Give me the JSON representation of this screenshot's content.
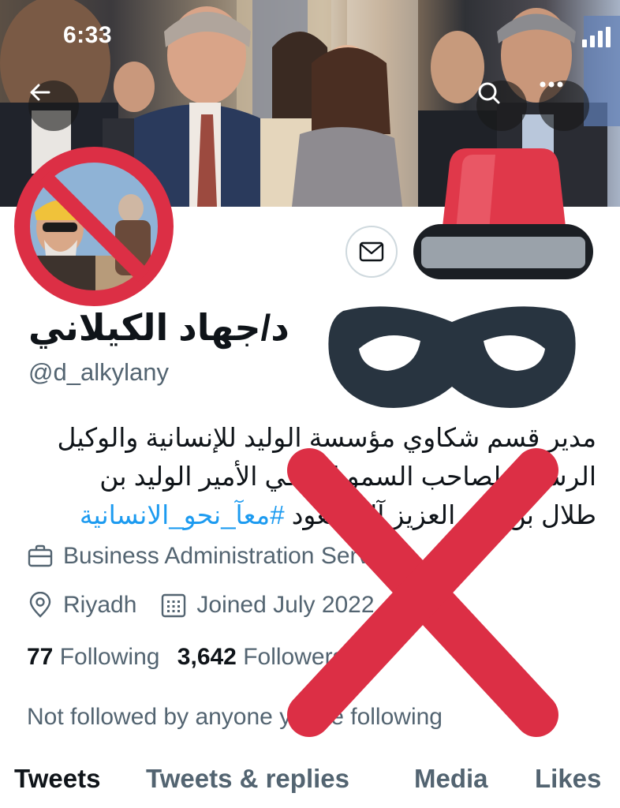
{
  "status_bar": {
    "time": "6:33"
  },
  "header": {
    "back_icon": "arrow-left-icon",
    "search_icon": "search-icon",
    "more_icon": "more-horizontal-icon"
  },
  "profile": {
    "display_name": "د/جهاد الكيلاني",
    "handle": "@d_alkylany",
    "bio_lines": [
      "مدير قسم شكاوي مؤسسة الوليد للإنسانية والوكيل",
      "الرسمي لصاحب السمو الملكي الأمير الوليد بن",
      "طلال بن عبد العزيز آل سعود"
    ],
    "bio_hashtag": "#معآ_نحو_الانسانية",
    "category": "Business Administration Service",
    "location": "Riyadh",
    "joined": "Joined July 2022",
    "following_count": "77",
    "following_label": "Following",
    "followers_count": "3,642",
    "followers_label": "Followers",
    "not_followed": "Not followed by anyone you’re following"
  },
  "tabs": [
    {
      "label": "Tweets",
      "active": true
    },
    {
      "label": "Tweets & replies",
      "active": false
    },
    {
      "label": "Media",
      "active": false
    },
    {
      "label": "Likes",
      "active": false
    }
  ],
  "colors": {
    "accent": "#1d9bf0",
    "overlay_red": "#dc2f45",
    "mask": "#283440",
    "hat": "#e0384a"
  }
}
